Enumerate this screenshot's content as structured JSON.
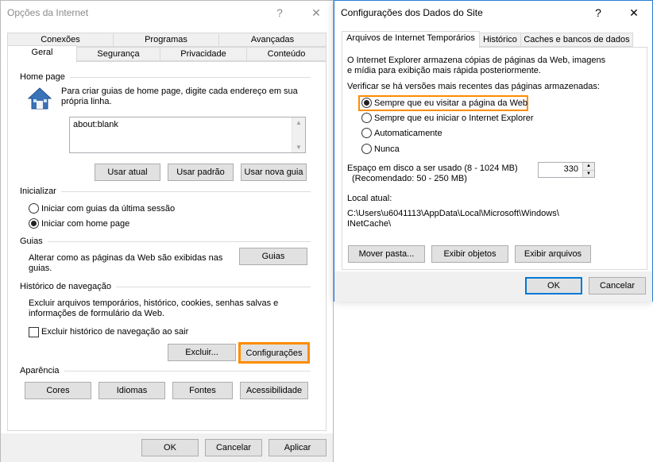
{
  "internet_options": {
    "title": "Opções da Internet",
    "help_glyph": "?",
    "close_glyph": "✕",
    "tabs_row1": [
      "Conexões",
      "Programas",
      "Avançadas"
    ],
    "tabs_row2": [
      "Geral",
      "Segurança",
      "Privacidade",
      "Conteúdo"
    ],
    "active_tab": "Geral",
    "homepage": {
      "section": "Home page",
      "description_line1": "Para criar guias de home page, digite cada endereço em sua",
      "description_line2": "própria linha.",
      "value": "about:blank",
      "buttons": [
        "Usar atual",
        "Usar padrão",
        "Usar nova guia"
      ]
    },
    "startup": {
      "section": "Inicializar",
      "options": [
        "Iniciar com guias da última sessão",
        "Iniciar com home page"
      ],
      "selected": "Iniciar com home page"
    },
    "tabs_section": {
      "section": "Guias",
      "description": "Alterar como as páginas da Web são exibidas nas guias.",
      "description_line1": "Alterar como as páginas da Web são exibidas nas",
      "description_line2": "guias.",
      "button": "Guias"
    },
    "history": {
      "section": "Histórico de navegação",
      "description_line1": "Excluir arquivos temporários, histórico, cookies, senhas salvas e",
      "description_line2": "informações de formulário da Web.",
      "checkbox": "Excluir histórico de navegação ao sair",
      "checked": false,
      "delete_button": "Excluir...",
      "settings_button": "Configurações"
    },
    "appearance": {
      "section": "Aparência",
      "buttons": [
        "Cores",
        "Idiomas",
        "Fontes",
        "Acessibilidade"
      ]
    },
    "footer": {
      "ok": "OK",
      "cancel": "Cancelar",
      "apply": "Aplicar"
    }
  },
  "site_data_settings": {
    "title": "Configurações dos Dados do Site",
    "help_glyph": "?",
    "close_glyph": "✕",
    "tabs": [
      "Arquivos de Internet Temporários",
      "Histórico",
      "Caches e bancos de dados"
    ],
    "active_tab": "Arquivos de Internet Temporários",
    "description_line1": "O Internet Explorer armazena cópias de páginas da Web, imagens",
    "description_line2": "e mídia para exibição mais rápida posteriormente.",
    "check_label": "Verificar se há versões mais recentes das páginas armazenadas:",
    "check_options": [
      "Sempre que eu visitar a página da Web",
      "Sempre que eu iniciar o Internet Explorer",
      "Automaticamente",
      "Nunca"
    ],
    "selected": "Sempre que eu visitar a página da Web",
    "disk_space_line1": "Espaço em disco a ser usado (8 - 1024 MB)",
    "disk_space_line2": "(Recomendado: 50 - 250 MB)",
    "disk_space_value": "330",
    "location_label": "Local atual:",
    "location_line1": "C:\\Users\\u6041113\\AppData\\Local\\Microsoft\\Windows\\",
    "location_line2": "INetCache\\",
    "buttons": [
      "Mover pasta...",
      "Exibir objetos",
      "Exibir arquivos"
    ],
    "footer": {
      "ok": "OK",
      "cancel": "Cancelar"
    }
  },
  "colors": {
    "highlight": "#ff8c00",
    "active_border": "#2b7cd3",
    "house_icon": "#3a73b8"
  }
}
